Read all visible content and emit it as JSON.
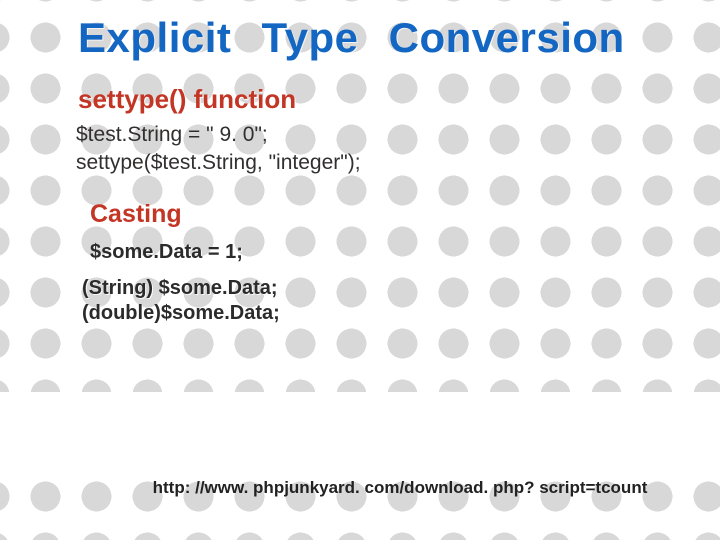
{
  "title": "Explicit Type Conversion",
  "section1": {
    "heading": "settype() function",
    "line1": "$test.String = \" 9. 0\";",
    "line2": " settype($test.String, \"integer\");"
  },
  "section2": {
    "heading": "Casting",
    "line1": "$some.Data = 1;",
    "line2": "(String) $some.Data;",
    "line3": "(double)$some.Data;"
  },
  "footer_link": "http: //www. phpjunkyard. com/download. php? script=tcount"
}
